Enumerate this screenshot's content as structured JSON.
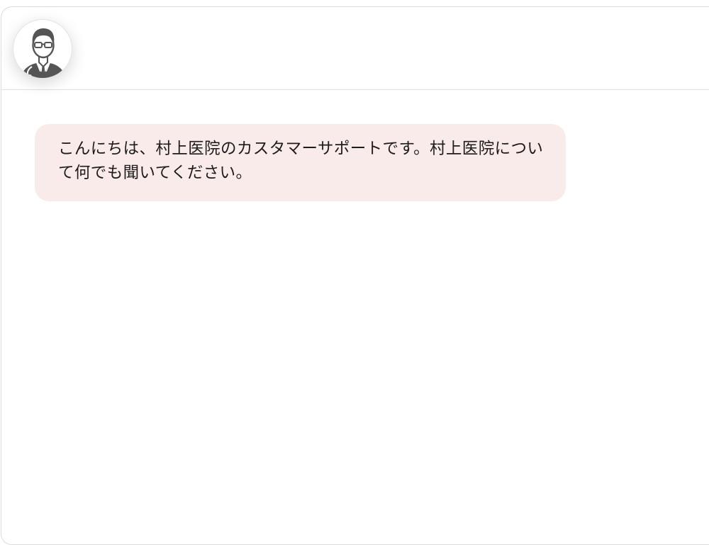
{
  "header": {
    "avatar_icon": "doctor-avatar-icon"
  },
  "messages": [
    {
      "sender": "bot",
      "text": "こんにちは、村上医院のカスタマーサポートです。村上医院について何でも聞いてください。",
      "background": "#f9ebea"
    }
  ],
  "colors": {
    "bubble_bot": "#f9ebea",
    "border": "#dcdcdc",
    "avatar_dark": "#555555"
  }
}
